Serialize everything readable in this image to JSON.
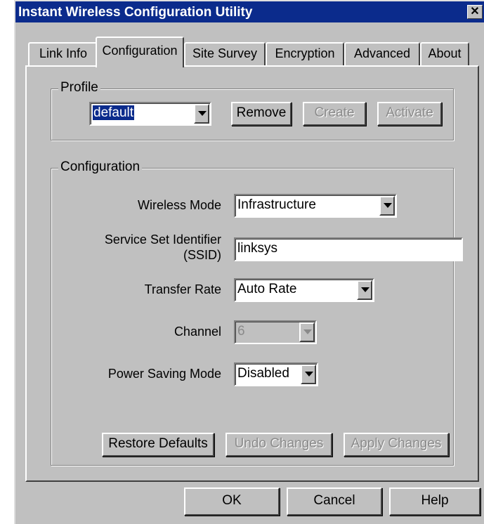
{
  "window": {
    "title": "Instant Wireless Configuration Utility",
    "close_glyph": "✕"
  },
  "tabs": [
    {
      "label": "Link Info",
      "active": false
    },
    {
      "label": "Configuration",
      "active": true
    },
    {
      "label": "Site Survey",
      "active": false
    },
    {
      "label": "Encryption",
      "active": false
    },
    {
      "label": "Advanced",
      "active": false
    },
    {
      "label": "About",
      "active": false
    }
  ],
  "profile": {
    "group_label": "Profile",
    "selected": "default",
    "remove_label": "Remove",
    "create_label": "Create",
    "activate_label": "Activate"
  },
  "configuration": {
    "group_label": "Configuration",
    "wireless_mode": {
      "label": "Wireless Mode",
      "value": "Infrastructure"
    },
    "ssid": {
      "label_line1": "Service Set Identifier",
      "label_line2": "(SSID)",
      "value": "linksys"
    },
    "transfer_rate": {
      "label": "Transfer Rate",
      "value": "Auto Rate"
    },
    "channel": {
      "label": "Channel",
      "value": "6",
      "disabled": true
    },
    "power_saving": {
      "label": "Power Saving Mode",
      "value": "Disabled"
    },
    "restore_label": "Restore Defaults",
    "undo_label": "Undo Changes",
    "apply_label": "Apply Changes"
  },
  "footer": {
    "ok_label": "OK",
    "cancel_label": "Cancel",
    "help_label": "Help"
  },
  "colors": {
    "titlebar": "#0b2b8c",
    "face": "#c0c0c0"
  }
}
